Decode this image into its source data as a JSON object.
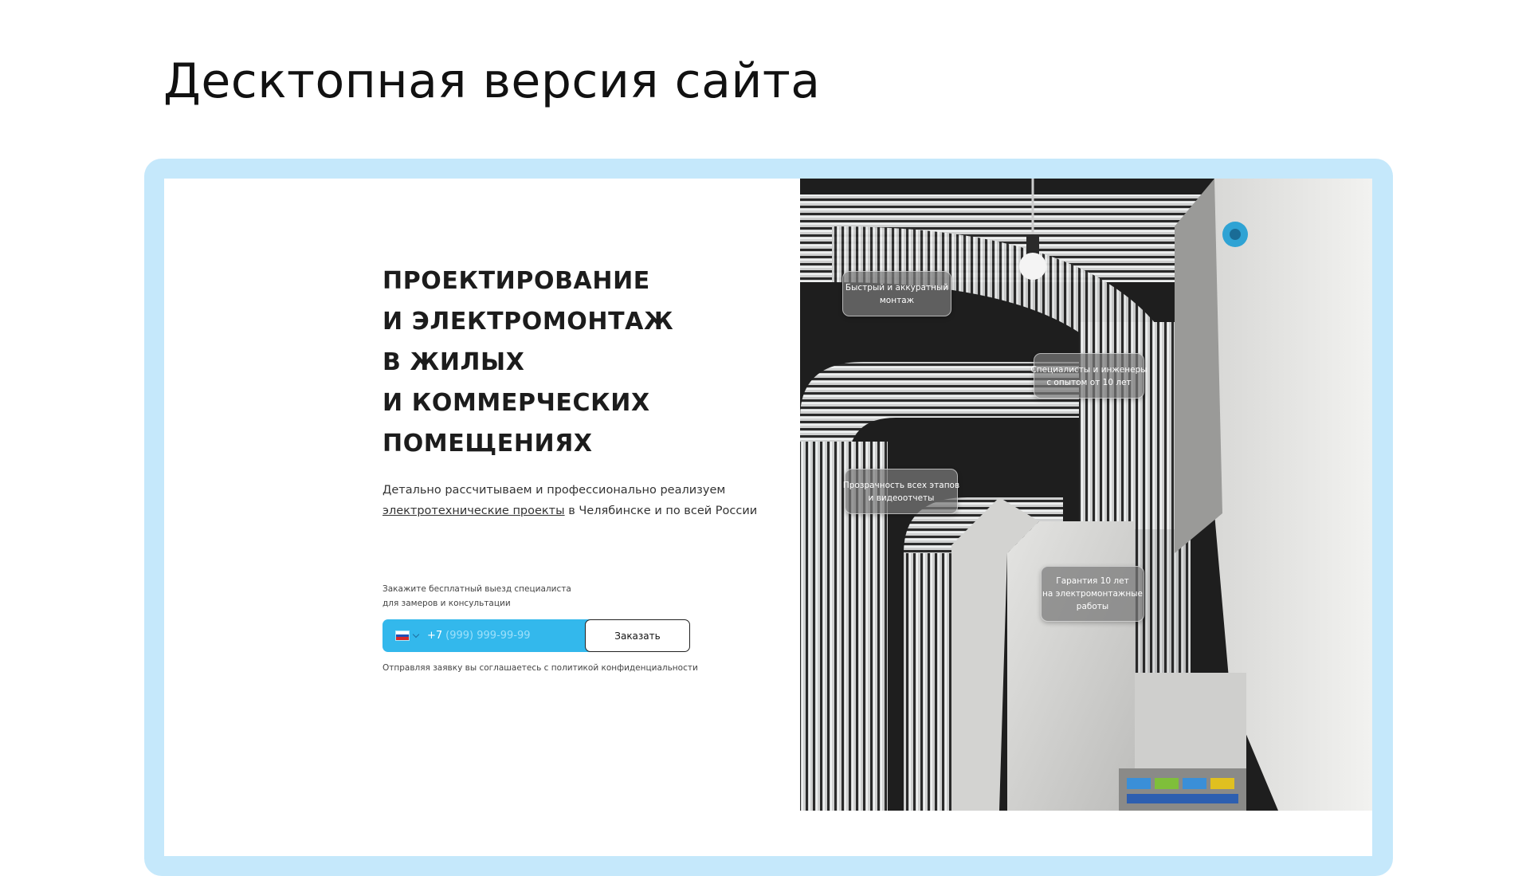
{
  "page": {
    "title": "Десктопная версия сайта"
  },
  "hero": {
    "headline_lines": [
      "ПРОЕКТИРОВАНИЕ",
      "И ЭЛЕКТРОМОНТАЖ",
      "В ЖИЛЫХ",
      "И КОММЕРЧЕСКИХ",
      "ПОМЕЩЕНИЯХ"
    ],
    "subtitle_line1": "Детально рассчитываем и профессионально реализуем",
    "subtitle_link": "электротехнические проекты",
    "subtitle_line2_rest": " в Челябинске и по всей России"
  },
  "form": {
    "caption_line1": "Закажите бесплатный выезд специалиста",
    "caption_line2": "для замеров и консультации",
    "country_flag": "russia-flag-icon",
    "phone_prefix": "+7",
    "phone_placeholder": "(999) 999-99-99",
    "submit_label": "Заказать",
    "policy_note": "Отправляя заявку вы соглашаетесь с политикой конфиденциальности"
  },
  "badges": [
    {
      "lines": [
        "Быстрый и аккуратный",
        "монтаж"
      ]
    },
    {
      "lines": [
        "Специалисты и инженеры",
        "с опытом от 10 лет"
      ]
    },
    {
      "lines": [
        "Прозрачность всех этапов",
        "и видеоотчеты"
      ]
    },
    {
      "lines": [
        "Гарантия 10 лет",
        "на электромонтажные",
        "работы"
      ]
    }
  ],
  "colors": {
    "frame": "#c5e8fb",
    "accent": "#33b8ec",
    "text": "#1c1c1c"
  }
}
